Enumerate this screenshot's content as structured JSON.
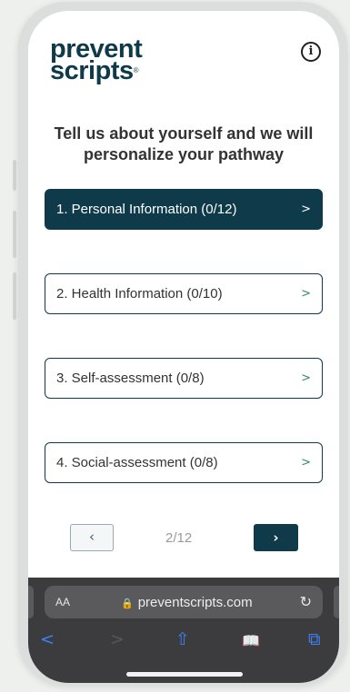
{
  "logo": {
    "line1": "prevent",
    "line2": "scripts",
    "mark": "®"
  },
  "info_icon": "i",
  "intro_text": "Tell us about yourself and we will personalize your pathway",
  "steps": [
    {
      "label": "1. Personal Information (0/12)",
      "active": true
    },
    {
      "label": "2. Health Information (0/10)",
      "active": false
    },
    {
      "label": "3. Self-assessment (0/8)",
      "active": false
    },
    {
      "label": "4. Social-assessment (0/8)",
      "active": false
    }
  ],
  "pager": {
    "prev": "‹",
    "counter": "2/12",
    "next": "›"
  },
  "browser": {
    "text_size": "AA",
    "lock": "🔒",
    "url": "preventscripts.com",
    "reload": "↻",
    "nav": {
      "back": "<",
      "forward": ">",
      "share": "⇧",
      "bookmarks": "📖",
      "tabs": "⧉"
    }
  },
  "colors": {
    "brand": "#0e3a4a",
    "accent_green": "#2f8a70",
    "toolbar": "#3c3c3f",
    "ios_blue": "#3b82f6"
  }
}
